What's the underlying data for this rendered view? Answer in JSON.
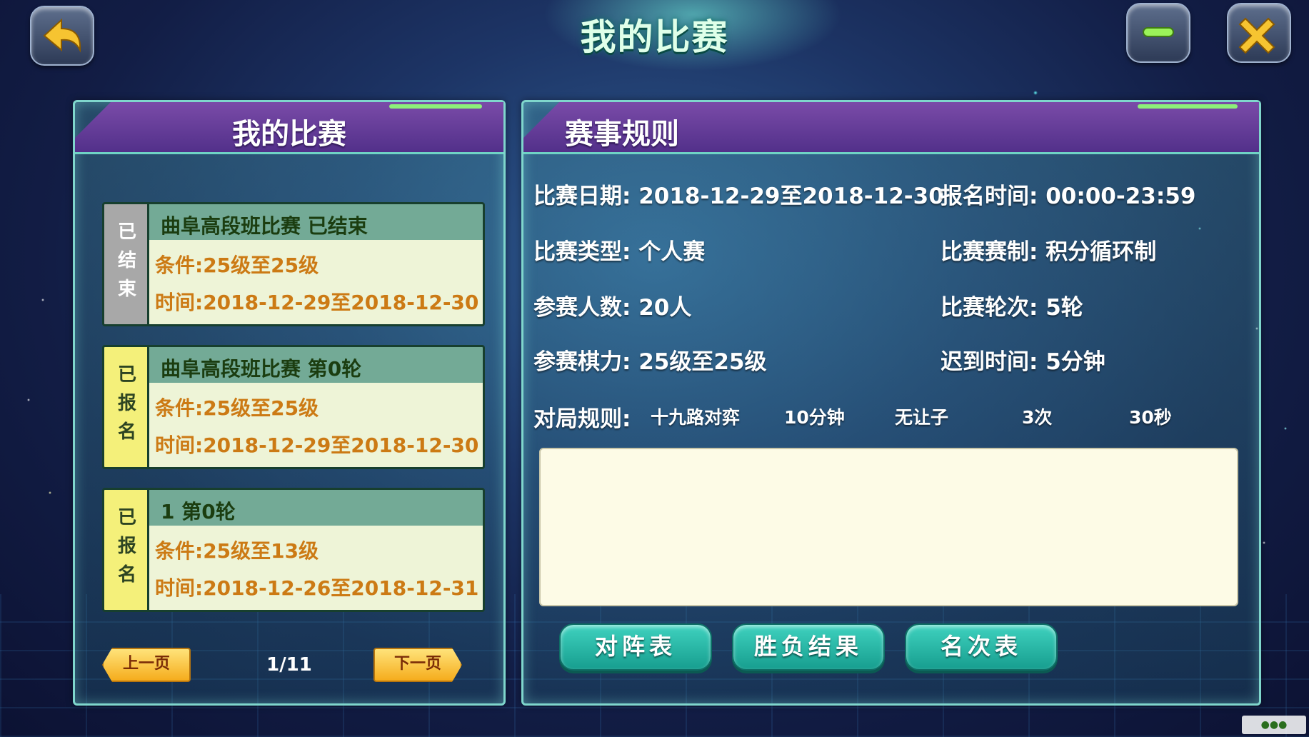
{
  "header": {
    "title": "我的比赛",
    "back_icon": "back-arrow-icon",
    "minimize_icon": "minimize-icon",
    "close_icon": "close-icon",
    "accent_color": "#f6c431"
  },
  "left_panel": {
    "title": "我的比赛",
    "matches": [
      {
        "status": "已结束",
        "name": "曲阜高段班比赛  已结束",
        "condition": "条件:25级至25级",
        "time": "时间:2018-12-29至2018-12-30",
        "status_color": "#a8a8a8"
      },
      {
        "status": "已报名",
        "name": "曲阜高段班比赛  第0轮",
        "condition": "条件:25级至25级",
        "time": "时间:2018-12-29至2018-12-30",
        "status_color": "#f4f07a"
      },
      {
        "status": "已报名",
        "name": "1  第0轮",
        "condition": "条件:25级至13级",
        "time": "时间:2018-12-26至2018-12-31",
        "status_color": "#f4f07a"
      }
    ],
    "pager": {
      "prev": "上一页",
      "next": "下一页",
      "info": "1/11"
    }
  },
  "right_panel": {
    "title": "赛事规则",
    "date": "比赛日期: 2018-12-29至2018-12-30",
    "signup_time": "报名时间: 00:00-23:59",
    "type": "比赛类型: 个人赛",
    "format": "比赛赛制: 积分循环制",
    "players": "参赛人数: 20人",
    "rounds": "比赛轮次: 5轮",
    "strength": "参赛棋力: 25级至25级",
    "late_time": "迟到时间: 5分钟",
    "game_rules": {
      "label": "对局规则:",
      "board": "十九路对弈",
      "time": "10分钟",
      "handicap": "无让子",
      "byoyomi_count": "3次",
      "byoyomi_time": "30秒"
    },
    "description": "",
    "buttons": {
      "pairings": "对阵表",
      "results": "胜负结果",
      "ranking": "名次表"
    }
  }
}
